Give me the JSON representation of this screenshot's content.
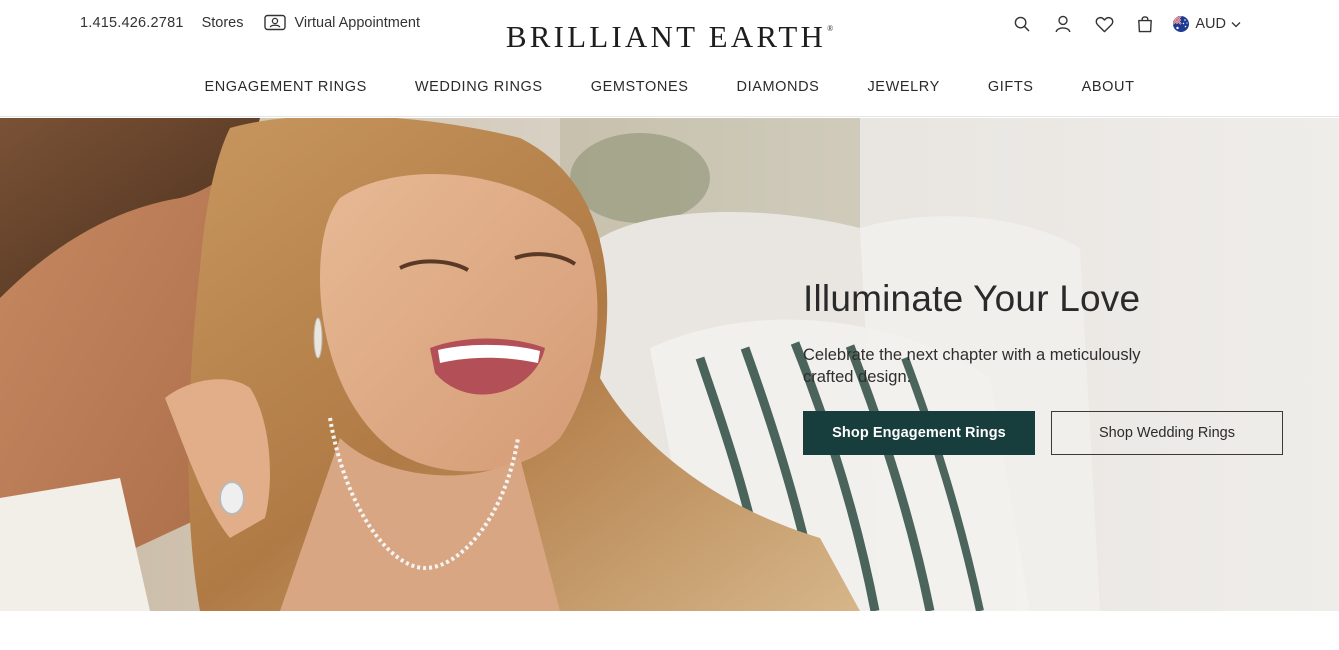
{
  "header": {
    "phone": "1.415.426.2781",
    "stores_label": "Stores",
    "virtual_appointment_label": "Virtual Appointment",
    "logo_text": "BRILLIANT EARTH",
    "logo_mark": "®",
    "currency": "AUD",
    "icons": [
      "search-icon",
      "account-icon",
      "wishlist-heart-icon",
      "shopping-bag-icon",
      "australia-flag-icon",
      "chevron-down-icon"
    ]
  },
  "nav": {
    "items": [
      {
        "label": "ENGAGEMENT RINGS"
      },
      {
        "label": "WEDDING RINGS"
      },
      {
        "label": "GEMSTONES"
      },
      {
        "label": "DIAMONDS"
      },
      {
        "label": "JEWELRY"
      },
      {
        "label": "GIFTS"
      },
      {
        "label": "ABOUT"
      }
    ]
  },
  "hero": {
    "title": "Illuminate Your Love",
    "subtitle": "Celebrate the next chapter with a meticulously crafted design.",
    "primary_cta": "Shop Engagement Rings",
    "secondary_cta": "Shop Wedding Rings"
  },
  "colors": {
    "brand_dark_green": "#173d3c",
    "text": "#2b2b2b",
    "hero_background": "#ece8e3"
  }
}
